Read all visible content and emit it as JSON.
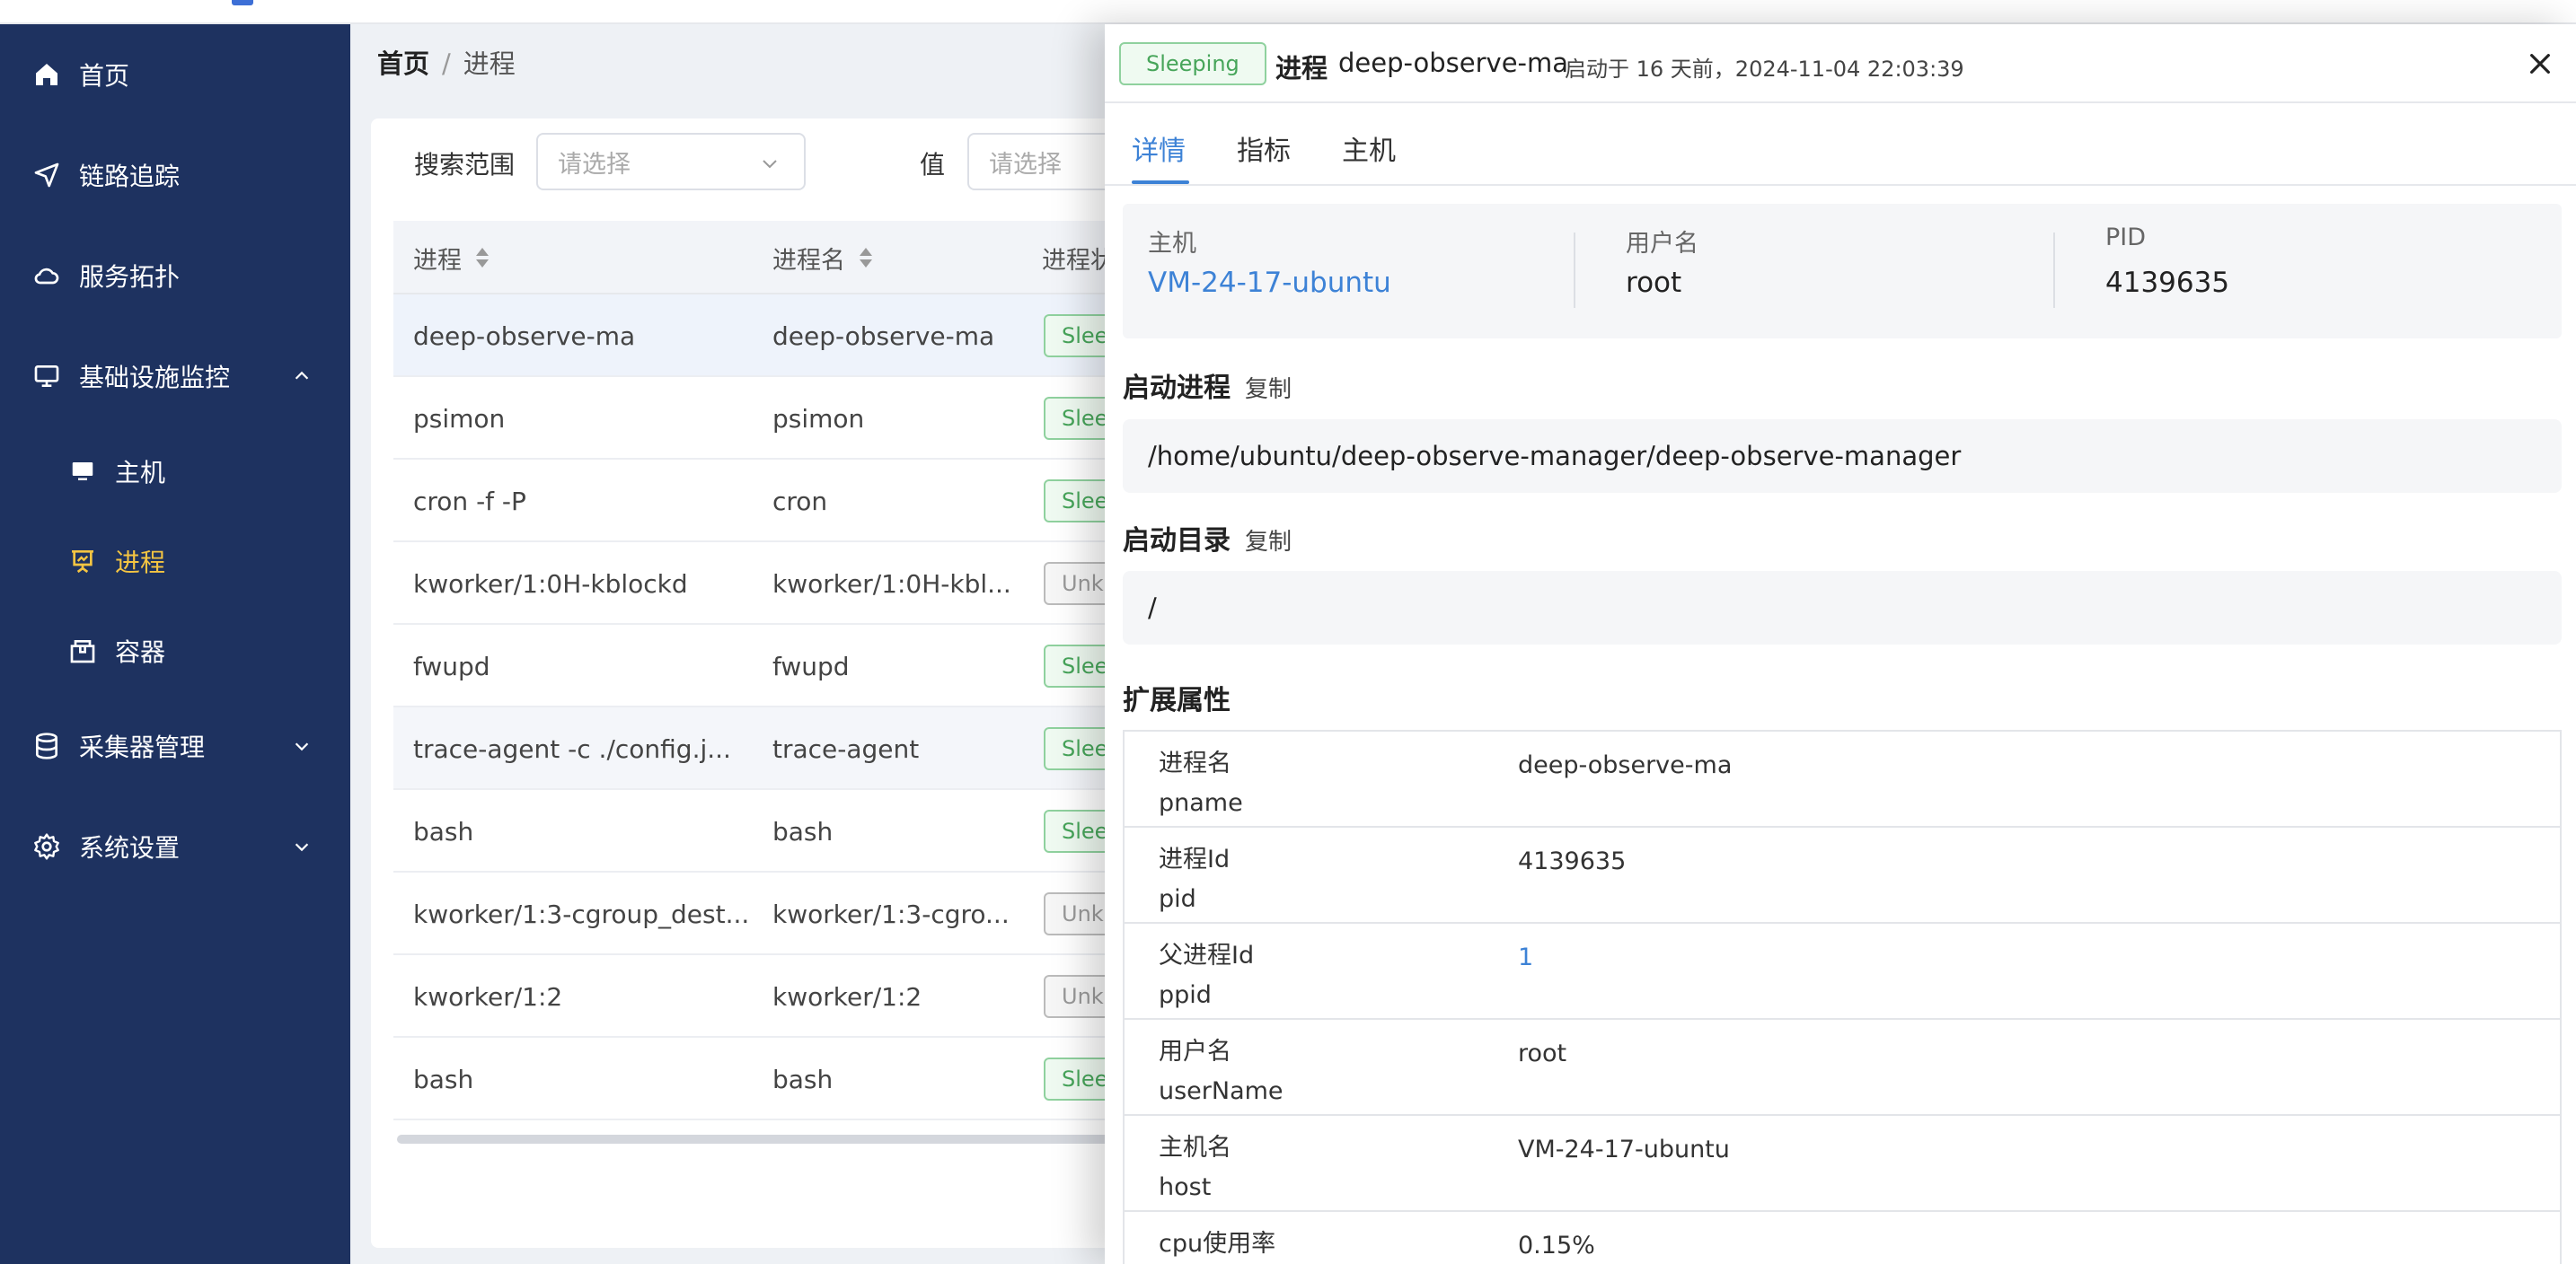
{
  "sidebar": {
    "items": [
      {
        "label": "首页",
        "icon": "home-icon"
      },
      {
        "label": "链路追踪",
        "icon": "send-icon"
      },
      {
        "label": "服务拓扑",
        "icon": "cloud-icon"
      },
      {
        "label": "基础设施监控",
        "icon": "monitor-icon",
        "expanded": true
      },
      {
        "label": "采集器管理",
        "icon": "database-icon"
      },
      {
        "label": "系统设置",
        "icon": "gear-icon"
      }
    ],
    "subitems": [
      {
        "label": "主机",
        "icon": "desktop-icon"
      },
      {
        "label": "进程",
        "icon": "presentation-icon",
        "active": true
      },
      {
        "label": "容器",
        "icon": "box-icon"
      }
    ],
    "active_color": "#f5c542"
  },
  "breadcrumb": {
    "home": "首页",
    "separator": "/",
    "current": "进程"
  },
  "filters": {
    "scope_label": "搜索范围",
    "scope_placeholder": "请选择",
    "value_label": "值",
    "value_placeholder": "请选择"
  },
  "table": {
    "columns": [
      "进程",
      "进程名",
      "进程状"
    ],
    "rows": [
      {
        "process": "deep-observe-ma",
        "name": "deep-observe-ma",
        "status": "Sleeping"
      },
      {
        "process": "psimon",
        "name": "psimon",
        "status": "Sleeping"
      },
      {
        "process": "cron  -f -P",
        "name": "cron",
        "status": "Sleeping"
      },
      {
        "process": "kworker/1:0H-kblockd",
        "name": "kworker/1:0H-kbl...",
        "status": "Unknown"
      },
      {
        "process": "fwupd",
        "name": "fwupd",
        "status": "Sleeping"
      },
      {
        "process": "trace-agent  -c ./config.j...",
        "name": "trace-agent",
        "status": "Sleeping"
      },
      {
        "process": "bash",
        "name": "bash",
        "status": "Sleeping"
      },
      {
        "process": "kworker/1:3-cgroup_dest...",
        "name": "kworker/1:3-cgro...",
        "status": "Unknown"
      },
      {
        "process": "kworker/1:2",
        "name": "kworker/1:2",
        "status": "Unknown"
      },
      {
        "process": "bash",
        "name": "bash",
        "status": "Sleeping"
      }
    ]
  },
  "drawer": {
    "status": "Sleeping",
    "title": "进程",
    "process_name": "deep-observe-ma",
    "started": "启动于 16 天前，2024-11-04 22:03:39",
    "tabs": [
      "详情",
      "指标",
      "主机"
    ],
    "summary": [
      {
        "label": "主机",
        "value": "VM-24-17-ubuntu"
      },
      {
        "label": "用户名",
        "value": "root"
      },
      {
        "label": "PID",
        "value": "4139635"
      }
    ],
    "start_cmd_title": "启动进程",
    "start_cmd_copy": "复制",
    "start_cmd": "/home/ubuntu/deep-observe-manager/deep-observe-manager",
    "start_dir_title": "启动目录",
    "start_dir_copy": "复制",
    "start_dir": "/",
    "ext_title": "扩展属性",
    "props": [
      {
        "cn": "进程名",
        "en": "pname",
        "value": "deep-observe-ma"
      },
      {
        "cn": "进程Id",
        "en": "pid",
        "value": "4139635"
      },
      {
        "cn": "父进程Id",
        "en": "ppid",
        "value": "1"
      },
      {
        "cn": "用户名",
        "en": "userName",
        "value": "root"
      },
      {
        "cn": "主机名",
        "en": "host",
        "value": "VM-24-17-ubuntu"
      },
      {
        "cn": "cpu使用率",
        "en": "",
        "value": "0.15%"
      }
    ]
  },
  "colors": {
    "sidebar_bg": "#1e3260",
    "link": "#3d82d6",
    "sleeping": "#47a55a"
  }
}
